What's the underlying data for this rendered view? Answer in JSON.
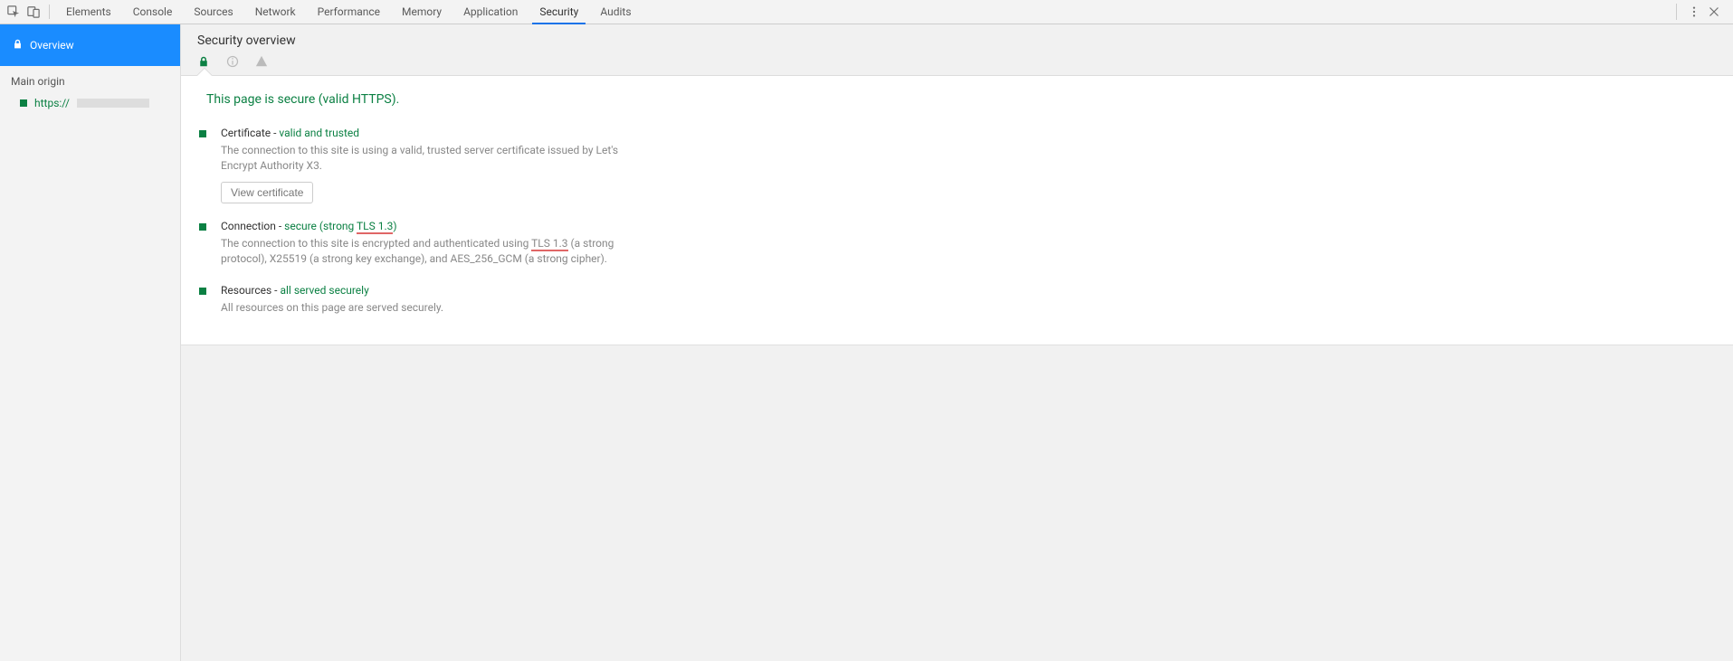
{
  "tabs": [
    "Elements",
    "Console",
    "Sources",
    "Network",
    "Performance",
    "Memory",
    "Application",
    "Security",
    "Audits"
  ],
  "active_tab": "Security",
  "sidebar": {
    "overview_label": "Overview",
    "section_label": "Main origin",
    "origin_prefix": "https://"
  },
  "header": {
    "title": "Security overview"
  },
  "headline": "This page is secure (valid HTTPS).",
  "blocks": {
    "cert": {
      "title_a": "Certificate - ",
      "title_b": "valid and trusted",
      "desc": "The connection to this site is using a valid, trusted server certificate issued by Let's Encrypt Authority X3.",
      "button": "View certificate"
    },
    "conn": {
      "title_a": "Connection - ",
      "title_b": "secure (strong ",
      "title_c": "TLS 1.3",
      "title_d": ")",
      "desc_a": "The connection to this site is encrypted and authenticated using ",
      "desc_b": "TLS 1.3",
      "desc_c": " (a strong protocol), X25519 (a strong key exchange), and AES_256_GCM (a strong cipher)."
    },
    "res": {
      "title_a": "Resources - ",
      "title_b": "all served securely",
      "desc": "All resources on this page are served securely."
    }
  }
}
